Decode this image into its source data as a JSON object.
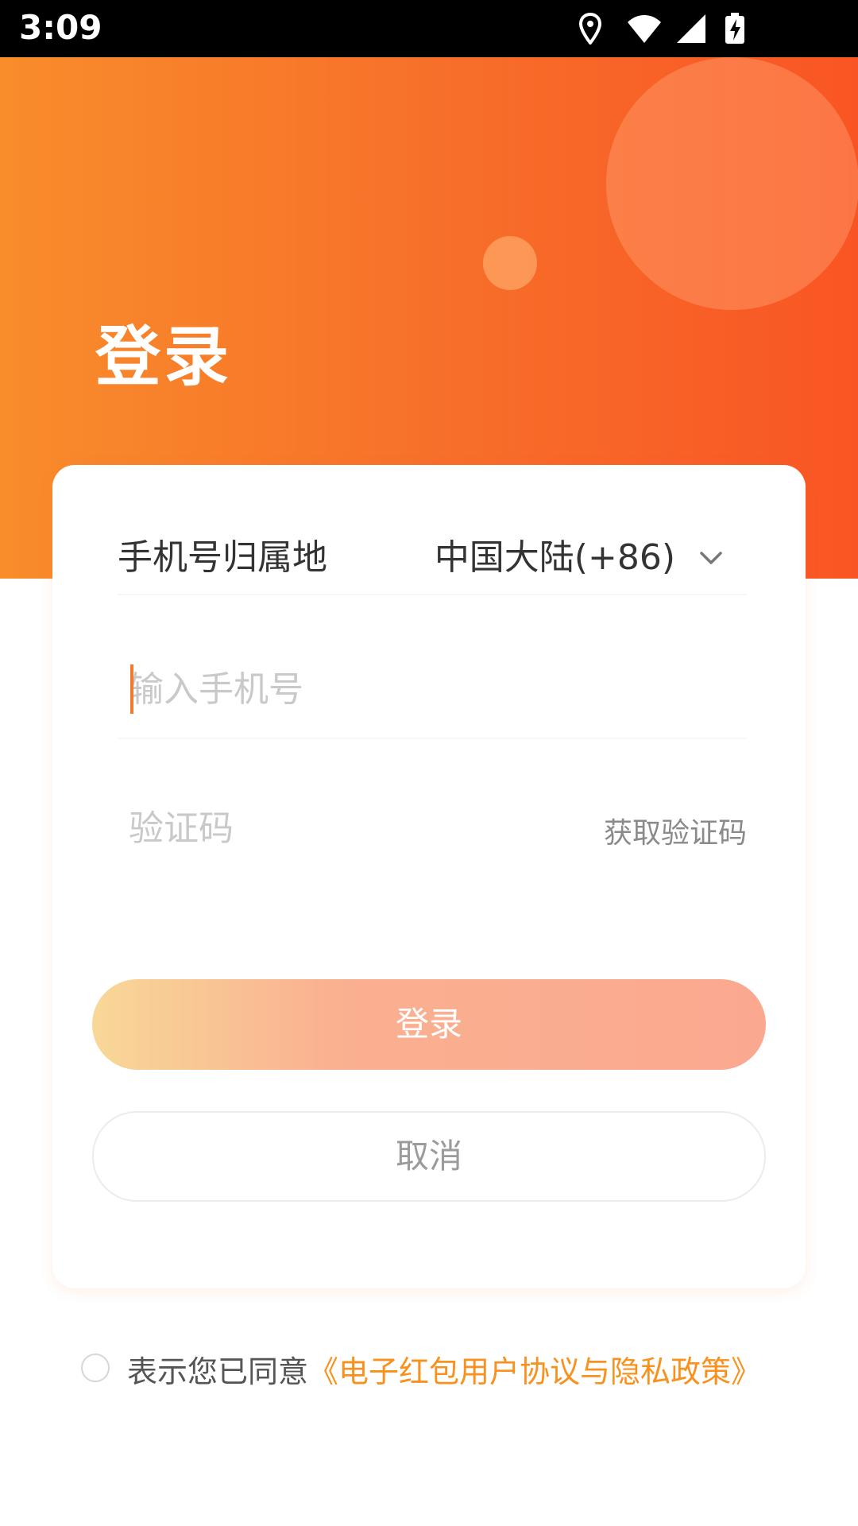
{
  "status_bar": {
    "time": "3:09",
    "icons": [
      "location-icon",
      "wifi-icon",
      "signal-icon",
      "battery-charging-icon"
    ]
  },
  "header": {
    "title": "登录"
  },
  "form": {
    "region_label": "手机号归属地",
    "region_value": "中国大陆(+86)",
    "phone_placeholder": "输入手机号",
    "code_placeholder": "验证码",
    "get_code_label": "获取验证码",
    "login_label": "登录",
    "cancel_label": "取消"
  },
  "agreement": {
    "prefix": "表示您已同意",
    "link": "《电子红包用户协议与隐私政策》"
  },
  "colors": {
    "accent": "#f7702a",
    "link": "#f8911d",
    "hero_start": "#f98c2b",
    "hero_end": "#f95524"
  }
}
